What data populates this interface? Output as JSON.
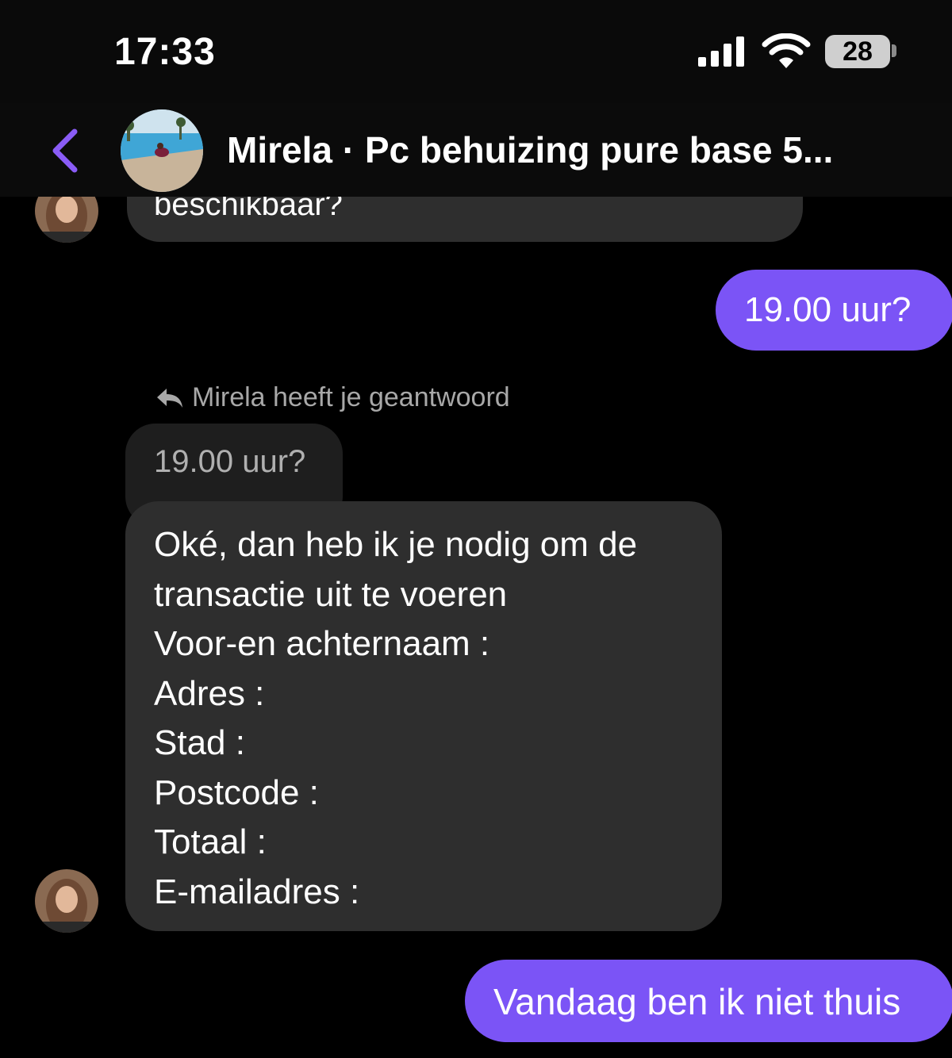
{
  "status_bar": {
    "time": "17:33",
    "battery_level": "28",
    "icons": [
      "signal-icon",
      "wifi-icon",
      "battery-icon"
    ]
  },
  "header": {
    "back_icon": "chevron-left-icon",
    "title": "Mirela · Pc behuizing pure base 5..."
  },
  "messages": {
    "partial_incoming": "beschikbaar?",
    "outgoing_1": "19.00 uur?",
    "reply_label": "Mirela heeft je geantwoord",
    "quoted_text": "19.00 uur?",
    "incoming_lines": [
      "Oké, dan heb ik je nodig om de",
      "transactie uit te voeren",
      "Voor-en achternaam :",
      "Adres :",
      "Stad :",
      "Postcode :",
      "Totaal :",
      "E-mailadres :"
    ],
    "outgoing_2": "Vandaag ben ik niet thuis"
  },
  "colors": {
    "background": "#000000",
    "incoming_bubble": "#2e2e2e",
    "outgoing_bubble": "#7b54f6",
    "accent": "#8a5cf6",
    "muted_text": "#a8a8a8"
  }
}
